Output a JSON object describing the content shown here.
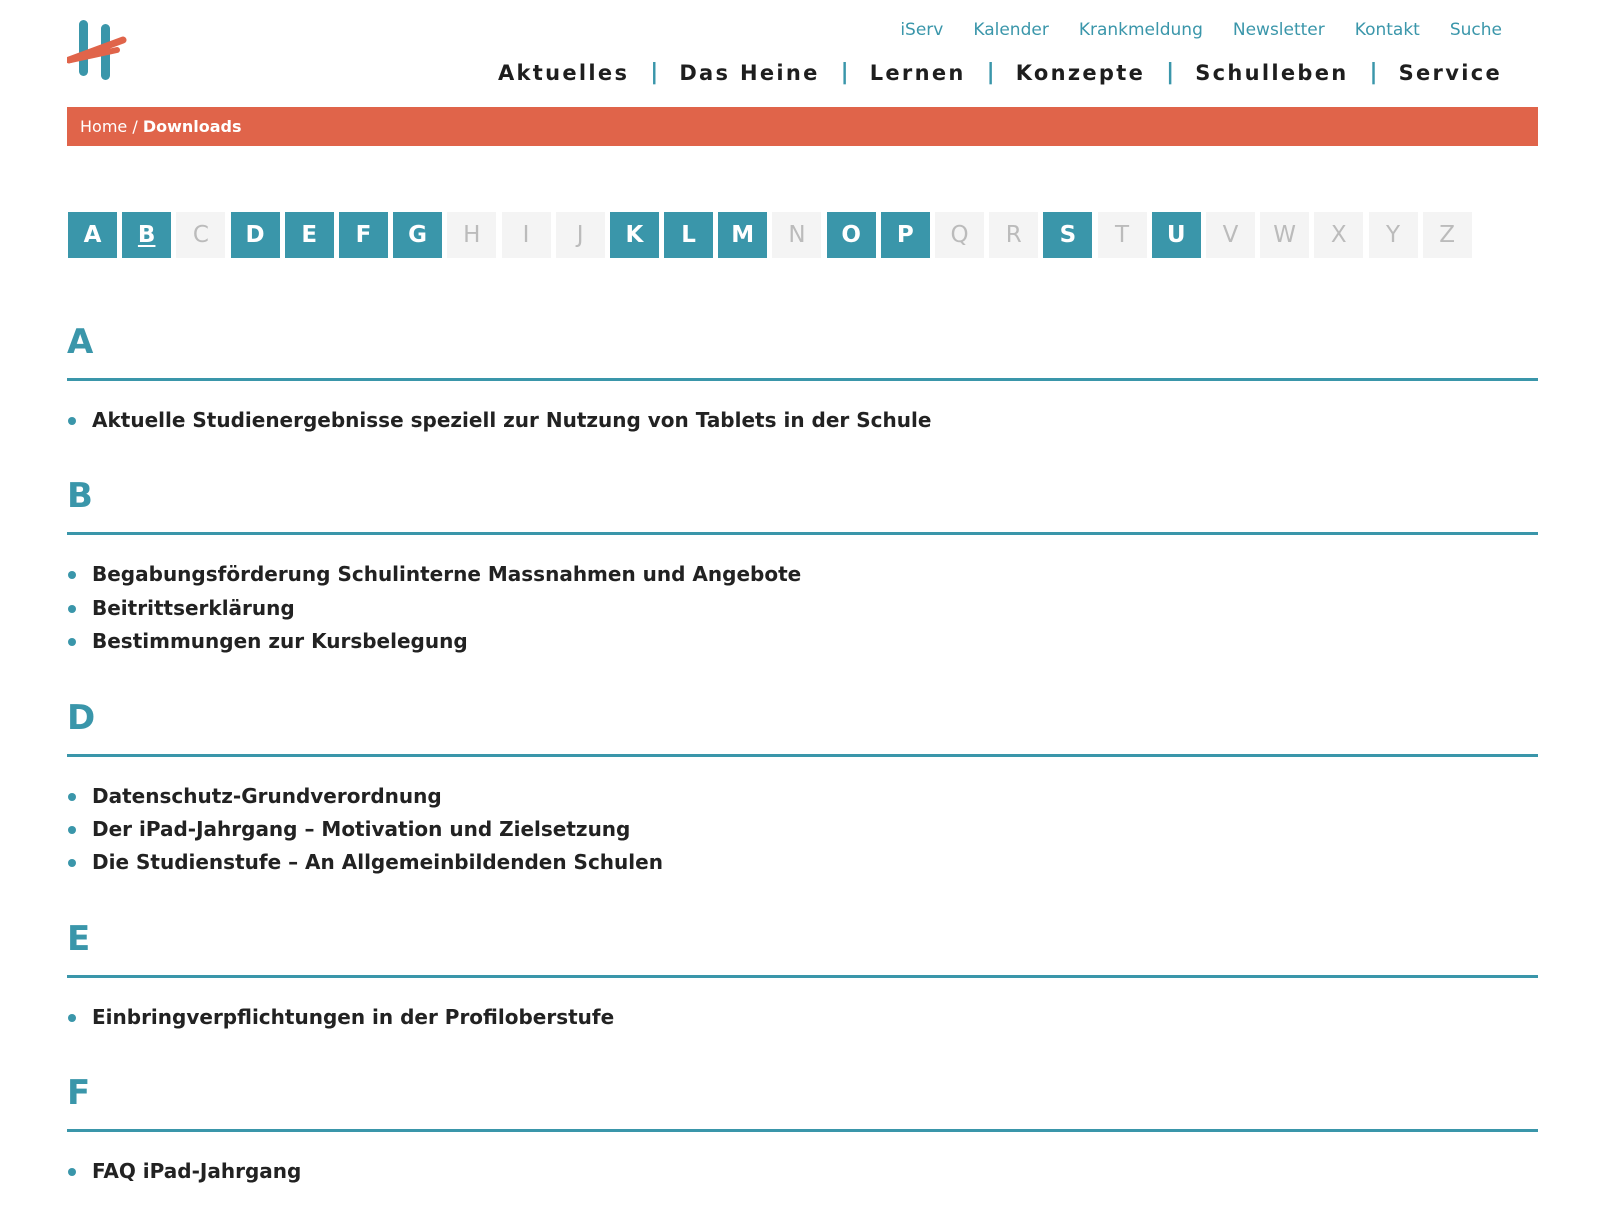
{
  "header": {
    "top_links": [
      "iServ",
      "Kalender",
      "Krankmeldung",
      "Newsletter",
      "Kontakt",
      "Suche"
    ],
    "main_nav": [
      "Aktuelles",
      "Das Heine",
      "Lernen",
      "Konzepte",
      "Schulleben",
      "Service"
    ],
    "nav_separator": "|"
  },
  "breadcrumb": {
    "home": "Home",
    "separator": "/",
    "current": "Downloads"
  },
  "alphabet": [
    {
      "letter": "A",
      "active": true
    },
    {
      "letter": "B",
      "active": true,
      "current": true
    },
    {
      "letter": "C",
      "active": false
    },
    {
      "letter": "D",
      "active": true
    },
    {
      "letter": "E",
      "active": true
    },
    {
      "letter": "F",
      "active": true
    },
    {
      "letter": "G",
      "active": true
    },
    {
      "letter": "H",
      "active": false
    },
    {
      "letter": "I",
      "active": false
    },
    {
      "letter": "J",
      "active": false
    },
    {
      "letter": "K",
      "active": true
    },
    {
      "letter": "L",
      "active": true
    },
    {
      "letter": "M",
      "active": true
    },
    {
      "letter": "N",
      "active": false
    },
    {
      "letter": "O",
      "active": true
    },
    {
      "letter": "P",
      "active": true
    },
    {
      "letter": "Q",
      "active": false
    },
    {
      "letter": "R",
      "active": false
    },
    {
      "letter": "S",
      "active": true
    },
    {
      "letter": "T",
      "active": false
    },
    {
      "letter": "U",
      "active": true
    },
    {
      "letter": "V",
      "active": false
    },
    {
      "letter": "W",
      "active": false
    },
    {
      "letter": "X",
      "active": false
    },
    {
      "letter": "Y",
      "active": false
    },
    {
      "letter": "Z",
      "active": false
    }
  ],
  "sections": [
    {
      "letter": "A",
      "items": [
        "Aktuelle Studienergebnisse speziell zur Nutzung von Tablets in der Schule"
      ]
    },
    {
      "letter": "B",
      "items": [
        "Begabungsförderung Schulinterne Massnahmen und Angebote",
        "Beitrittserklärung",
        "Bestimmungen zur Kursbelegung"
      ]
    },
    {
      "letter": "D",
      "items": [
        "Datenschutz-Grundverordnung",
        "Der iPad-Jahrgang – Motivation und Zielsetzung",
        "Die Studienstufe – An Allgemeinbildenden Schulen"
      ]
    },
    {
      "letter": "E",
      "items": [
        "Einbringverpflichtungen in der Profiloberstufe"
      ]
    },
    {
      "letter": "F",
      "items": [
        "FAQ iPad-Jahrgang"
      ]
    }
  ],
  "colors": {
    "accent": "#3a96aa",
    "brand_red": "#e0644a",
    "inactive_bg": "#f4f4f4",
    "inactive_text": "#bbbbbb"
  },
  "icons": {
    "logo": "heine-h-logo"
  }
}
